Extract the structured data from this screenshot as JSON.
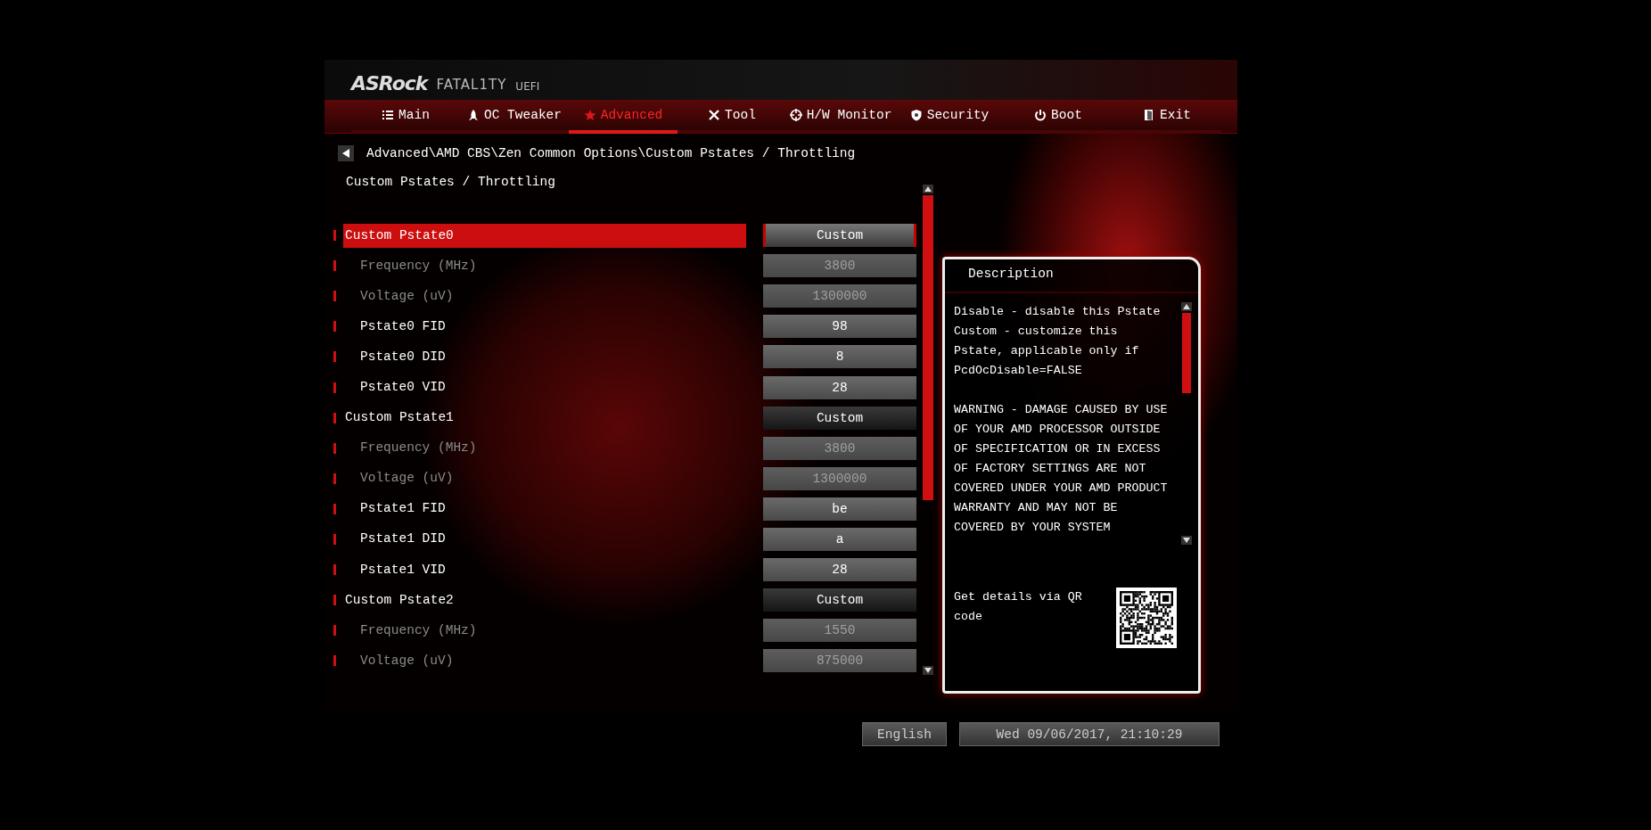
{
  "header": {
    "brand": "ASRock",
    "series": "FATAL1TY",
    "suffix": "UEFI"
  },
  "tabs": [
    {
      "label": "Main",
      "selected": false
    },
    {
      "label": "OC Tweaker",
      "selected": false
    },
    {
      "label": "Advanced",
      "selected": true
    },
    {
      "label": "Tool",
      "selected": false
    },
    {
      "label": "H/W Monitor",
      "selected": false
    },
    {
      "label": "Security",
      "selected": false
    },
    {
      "label": "Boot",
      "selected": false
    },
    {
      "label": "Exit",
      "selected": false
    }
  ],
  "breadcrumb": "Advanced\\AMD CBS\\Zen Common Options\\Custom Pstates / Throttling",
  "page_title": "Custom Pstates / Throttling",
  "settings": [
    {
      "kind": "group",
      "label": "Custom Pstate0",
      "value": "Custom",
      "selected": true,
      "disabled": false
    },
    {
      "kind": "item",
      "label": "Frequency (MHz)",
      "value": "3800",
      "selected": false,
      "disabled": true
    },
    {
      "kind": "item",
      "label": "Voltage (uV)",
      "value": "1300000",
      "selected": false,
      "disabled": true
    },
    {
      "kind": "item",
      "label": "Pstate0 FID",
      "value": "98",
      "selected": false,
      "disabled": false
    },
    {
      "kind": "item",
      "label": "Pstate0 DID",
      "value": "8",
      "selected": false,
      "disabled": false
    },
    {
      "kind": "item",
      "label": "Pstate0 VID",
      "value": "28",
      "selected": false,
      "disabled": false
    },
    {
      "kind": "group",
      "label": "Custom Pstate1",
      "value": "Custom",
      "selected": false,
      "disabled": false
    },
    {
      "kind": "item",
      "label": "Frequency (MHz)",
      "value": "3800",
      "selected": false,
      "disabled": true
    },
    {
      "kind": "item",
      "label": "Voltage (uV)",
      "value": "1300000",
      "selected": false,
      "disabled": true
    },
    {
      "kind": "item",
      "label": "Pstate1 FID",
      "value": "be",
      "selected": false,
      "disabled": false
    },
    {
      "kind": "item",
      "label": "Pstate1 DID",
      "value": "a",
      "selected": false,
      "disabled": false
    },
    {
      "kind": "item",
      "label": "Pstate1 VID",
      "value": "28",
      "selected": false,
      "disabled": false
    },
    {
      "kind": "group",
      "label": "Custom Pstate2",
      "value": "Custom",
      "selected": false,
      "disabled": false
    },
    {
      "kind": "item",
      "label": "Frequency (MHz)",
      "value": "1550",
      "selected": false,
      "disabled": true
    },
    {
      "kind": "item",
      "label": "Voltage (uV)",
      "value": "875000",
      "selected": false,
      "disabled": true
    }
  ],
  "description": {
    "title": "Description",
    "paragraphs": [
      "Disable - disable this Pstate Custom - customize this Pstate, applicable only if PcdOcDisable=FALSE",
      "WARNING - DAMAGE CAUSED BY USE OF YOUR AMD PROCESSOR OUTSIDE OF SPECIFICATION OR IN EXCESS OF FACTORY SETTINGS ARE NOT COVERED UNDER YOUR AMD PRODUCT WARRANTY AND MAY NOT BE COVERED BY YOUR SYSTEM"
    ],
    "qr_text": "Get details via QR code"
  },
  "footer": {
    "language": "English",
    "datetime": "Wed 09/06/2017, 21:10:29"
  }
}
